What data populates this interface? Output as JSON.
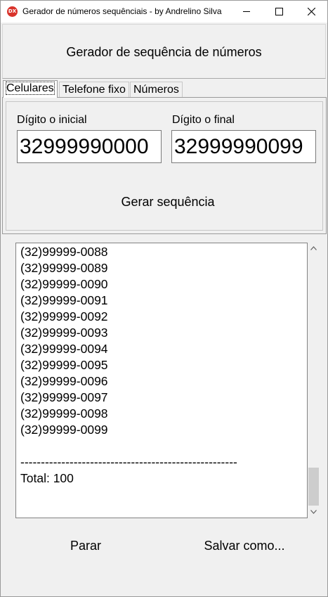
{
  "window": {
    "title": "Gerador de números sequênciais - by Andrelino Silva",
    "icon_text": "DX"
  },
  "header": {
    "title": "Gerador de sequência de números"
  },
  "tabs": [
    {
      "label": "Celulares",
      "active": true
    },
    {
      "label": "Telefone fixo",
      "active": false
    },
    {
      "label": "Números",
      "active": false
    }
  ],
  "form": {
    "initial_label": "Dígito o inicial",
    "initial_value": "32999990000",
    "final_label": "Dígito o final",
    "final_value": "32999990099",
    "generate_label": "Gerar sequência"
  },
  "output": {
    "lines": [
      "(32)99999-0088",
      "(32)99999-0089",
      "(32)99999-0090",
      "(32)99999-0091",
      "(32)99999-0092",
      "(32)99999-0093",
      "(32)99999-0094",
      "(32)99999-0095",
      "(32)99999-0096",
      "(32)99999-0097",
      "(32)99999-0098",
      "(32)99999-0099",
      "",
      "-----------------------------------------------------",
      "Total: 100"
    ]
  },
  "actions": {
    "stop_label": "Parar",
    "save_label": "Salvar como..."
  },
  "icons": {
    "minimize": "minimize-icon",
    "maximize": "maximize-icon",
    "close": "close-icon",
    "scroll_up": "chevron-up-icon",
    "scroll_down": "chevron-down-icon"
  },
  "colors": {
    "app_icon": "#d9332b",
    "window_bg": "#f0f0f0",
    "field_bg": "#ffffff",
    "scroll_thumb": "#cdcdcd"
  }
}
